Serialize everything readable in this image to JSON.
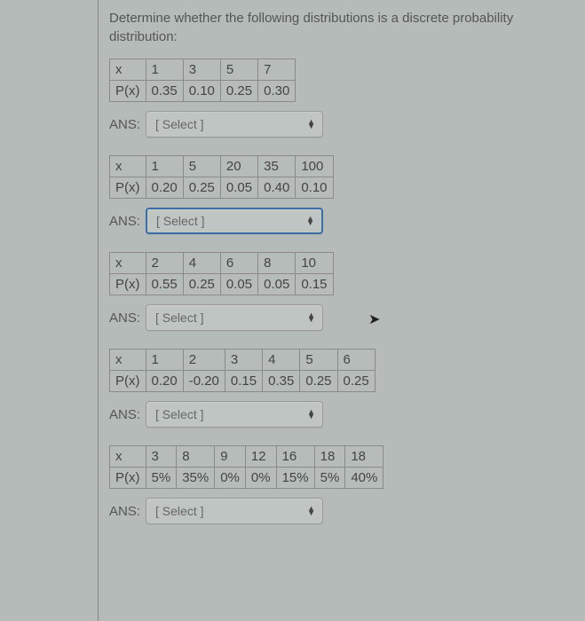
{
  "prompt": "Determine whether the following distributions is a discrete probability distribution:",
  "ans_label": "ANS:",
  "select_placeholder": "[ Select ]",
  "row_labels": {
    "x": "x",
    "px": "P(x)"
  },
  "questions": [
    {
      "focused": false,
      "x": [
        "1",
        "3",
        "5",
        "7"
      ],
      "px": [
        "0.35",
        "0.10",
        "0.25",
        "0.30"
      ]
    },
    {
      "focused": true,
      "x": [
        "1",
        "5",
        "20",
        "35",
        "100"
      ],
      "px": [
        "0.20",
        "0.25",
        "0.05",
        "0.40",
        "0.10"
      ]
    },
    {
      "focused": false,
      "x": [
        "2",
        "4",
        "6",
        "8",
        "10"
      ],
      "px": [
        "0.55",
        "0.25",
        "0.05",
        "0.05",
        "0.15"
      ]
    },
    {
      "focused": false,
      "x": [
        "1",
        "2",
        "3",
        "4",
        "5",
        "6"
      ],
      "px": [
        "0.20",
        "-0.20",
        "0.15",
        "0.35",
        "0.25",
        "0.25"
      ]
    },
    {
      "focused": false,
      "x": [
        "3",
        "8",
        "9",
        "12",
        "16",
        "18",
        "18"
      ],
      "px": [
        "5%",
        "35%",
        "0%",
        "0%",
        "15%",
        "5%",
        "40%"
      ]
    }
  ]
}
